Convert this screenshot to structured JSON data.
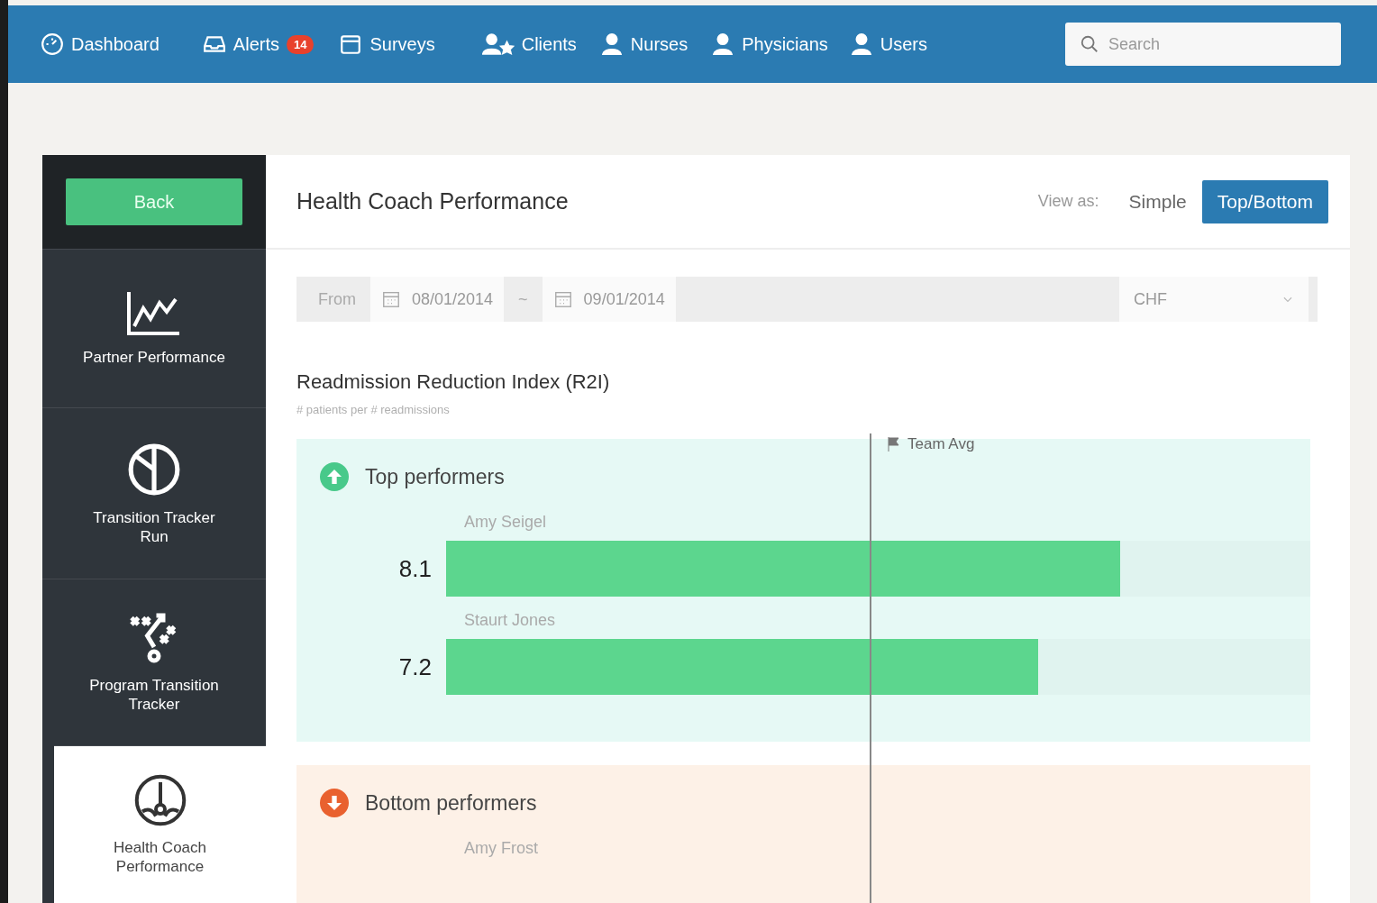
{
  "nav": {
    "items": [
      {
        "kind": "dashboard",
        "label": "Dashboard"
      },
      {
        "kind": "alerts",
        "label": "Alerts",
        "badge": "14"
      },
      {
        "kind": "surveys",
        "label": "Surveys"
      },
      {
        "kind": "clients",
        "label": "Clients"
      },
      {
        "kind": "person",
        "label": "Nurses"
      },
      {
        "kind": "person",
        "label": "Physicians"
      },
      {
        "kind": "person",
        "label": "Users"
      }
    ],
    "search": {
      "placeholder": "Search"
    }
  },
  "sidebar": {
    "back": "Back",
    "items": [
      {
        "kind": "line-chart",
        "label": "Partner Performance",
        "selected": false
      },
      {
        "kind": "pie",
        "label": "Transition Tracker Run",
        "selected": false
      },
      {
        "kind": "play",
        "label": "Program Transition Tracker",
        "selected": false
      },
      {
        "kind": "gauge",
        "label": "Health Coach Performance",
        "selected": true
      }
    ]
  },
  "header": {
    "title": "Health Coach Performance",
    "view_as": "View as:",
    "views": [
      {
        "label": "Simple",
        "selected": false
      },
      {
        "label": "Top/Bottom",
        "selected": true
      }
    ]
  },
  "filters": {
    "from_label": "From",
    "from": "08/01/2014",
    "separator": "~",
    "to": "09/01/2014",
    "condition": "CHF"
  },
  "metric": {
    "title": "Readmission Reduction Index (R2I)",
    "subtitle": "# patients per # readmissions",
    "team_avg": "Team Avg",
    "groups": [
      {
        "kind": "top",
        "title": "Top performers",
        "rows": [
          {
            "name": "Amy Seigel",
            "value": "8.1",
            "level": 0.78
          },
          {
            "name": "Staurt Jones",
            "value": "7.2",
            "level": 0.685
          }
        ]
      },
      {
        "kind": "bottom",
        "title": "Bottom performers",
        "rows": [
          {
            "name": "Amy Frost"
          }
        ]
      }
    ]
  }
}
